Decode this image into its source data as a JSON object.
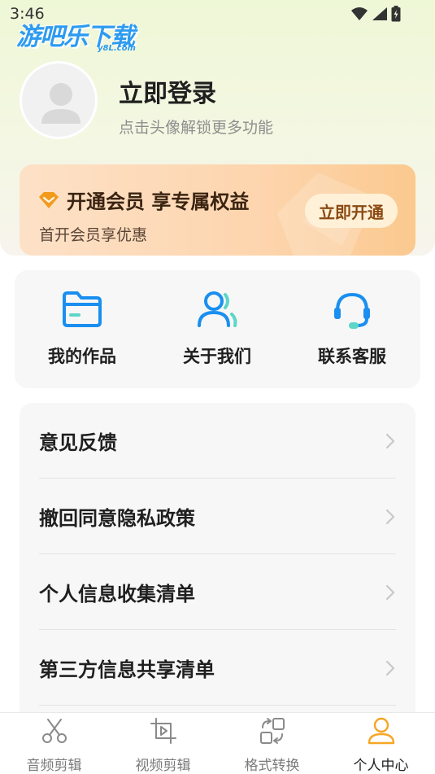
{
  "status_bar": {
    "time": "3:46",
    "icons": [
      "wifi-icon",
      "signal-icon",
      "battery-icon"
    ]
  },
  "watermark": {
    "text": "游吧乐下载",
    "sub": "y8L.com"
  },
  "profile": {
    "title": "立即登录",
    "subtitle": "点击头像解锁更多功能"
  },
  "vip": {
    "title": "开通会员 享专属权益",
    "subtitle": "首开会员享优惠",
    "button": "立即开通"
  },
  "quick_actions": [
    {
      "label": "我的作品",
      "icon": "folder-icon"
    },
    {
      "label": "关于我们",
      "icon": "users-icon"
    },
    {
      "label": "联系客服",
      "icon": "headset-icon"
    }
  ],
  "menu": [
    {
      "label": "意见反馈"
    },
    {
      "label": "撤回同意隐私政策"
    },
    {
      "label": "个人信息收集清单"
    },
    {
      "label": "第三方信息共享清单"
    }
  ],
  "tabs": [
    {
      "label": "音频剪辑",
      "icon": "scissors-icon",
      "active": false
    },
    {
      "label": "视频剪辑",
      "icon": "video-crop-icon",
      "active": false
    },
    {
      "label": "格式转换",
      "icon": "convert-icon",
      "active": false
    },
    {
      "label": "个人中心",
      "icon": "person-icon",
      "active": true
    }
  ],
  "colors": {
    "accent": "#f5a623",
    "link_blue": "#1a8ff0",
    "vip_brown": "#3a2311"
  }
}
